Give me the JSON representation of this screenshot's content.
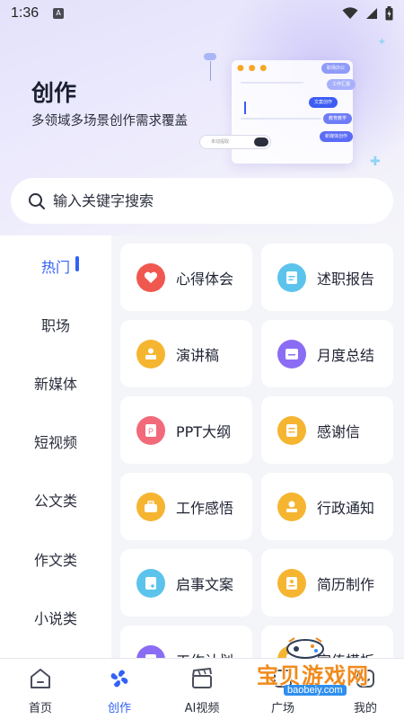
{
  "status_bar": {
    "time": "1:36",
    "app_icon": "A"
  },
  "hero": {
    "title": "创作",
    "subtitle": "多领域多场景创作需求覆盖",
    "illustration": {
      "search_placeholder": "未动提取",
      "chips": [
        "职场办公",
        "工作汇报",
        "文案创作",
        "教育教学",
        "新媒体创作"
      ]
    }
  },
  "search": {
    "placeholder": "输入关键字搜索"
  },
  "sidebar": {
    "items": [
      {
        "label": "热门",
        "active": true
      },
      {
        "label": "职场",
        "active": false
      },
      {
        "label": "新媒体",
        "active": false
      },
      {
        "label": "短视频",
        "active": false
      },
      {
        "label": "公文类",
        "active": false
      },
      {
        "label": "作文类",
        "active": false
      },
      {
        "label": "小说类",
        "active": false
      }
    ]
  },
  "tiles": [
    {
      "label": "心得体会",
      "icon": "heart-icon",
      "color": "#f0584f"
    },
    {
      "label": "述职报告",
      "icon": "document-icon",
      "color": "#5cc4ec"
    },
    {
      "label": "演讲稿",
      "icon": "speaker-icon",
      "color": "#f6b531"
    },
    {
      "label": "月度总结",
      "icon": "calendar-card-icon",
      "color": "#8b6cf4"
    },
    {
      "label": "PPT大纲",
      "icon": "ppt-icon",
      "color": "#f26a7a"
    },
    {
      "label": "感谢信",
      "icon": "letter-icon",
      "color": "#f6b531"
    },
    {
      "label": "工作感悟",
      "icon": "briefcase-icon",
      "color": "#f6b531"
    },
    {
      "label": "行政通知",
      "icon": "stamp-icon",
      "color": "#f6b531"
    },
    {
      "label": "启事文案",
      "icon": "notice-icon",
      "color": "#5cc4ec"
    },
    {
      "label": "简历制作",
      "icon": "resume-icon",
      "color": "#f6b531"
    },
    {
      "label": "工作计划",
      "icon": "plan-icon",
      "color": "#8b6cf4"
    },
    {
      "label": "宣传模板",
      "icon": "template-icon",
      "color": "#f6b531"
    }
  ],
  "bottom_nav": [
    {
      "label": "首页",
      "icon": "home-icon",
      "active": false
    },
    {
      "label": "创作",
      "icon": "fan-icon",
      "active": true
    },
    {
      "label": "AI视频",
      "icon": "clapper-icon",
      "active": false
    },
    {
      "label": "广场",
      "icon": "square-icon",
      "active": false
    },
    {
      "label": "我的",
      "icon": "profile-icon",
      "active": false
    }
  ],
  "watermark": {
    "title": "宝贝游戏网",
    "url": "baobeiy.com"
  },
  "colors": {
    "accent": "#3361f5",
    "background": "#f4f5f9"
  }
}
